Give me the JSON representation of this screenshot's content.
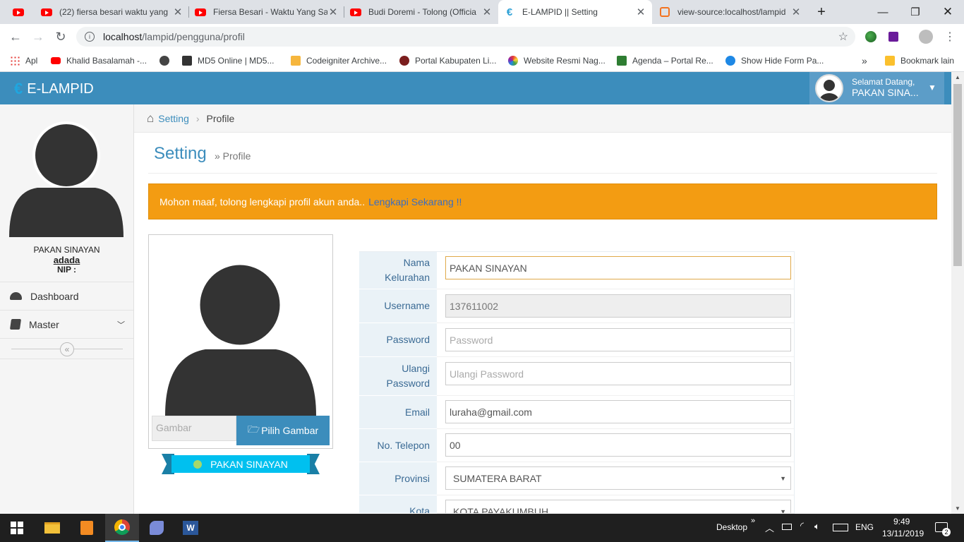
{
  "browser": {
    "tabs": [
      {
        "title": "(22) fiersa besari waktu yang",
        "icon": "youtube-icon"
      },
      {
        "title": "Fiersa Besari - Waktu Yang Sa",
        "icon": "youtube-icon"
      },
      {
        "title": "Budi Doremi - Tolong (Officia",
        "icon": "youtube-icon"
      },
      {
        "title": "E-LAMPID || Setting",
        "icon": "elampid-icon",
        "active": true
      },
      {
        "title": "view-source:localhost/lampid",
        "icon": "xampp-icon"
      }
    ],
    "url_host": "localhost",
    "url_path": "/lampid/pengguna/profil",
    "bookmarks": [
      {
        "label": "Apl"
      },
      {
        "label": "Khalid Basalamah -..."
      },
      {
        "label": ""
      },
      {
        "label": "MD5 Online | MD5..."
      },
      {
        "label": "Codeigniter Archive..."
      },
      {
        "label": "Portal Kabupaten Li..."
      },
      {
        "label": "Website Resmi Nag..."
      },
      {
        "label": "Agenda – Portal Re..."
      },
      {
        "label": "Show Hide Form Pa..."
      }
    ],
    "bookmark_more": "»",
    "bookmark_other": "Bookmark lain"
  },
  "app": {
    "brand": "E-LAMPID",
    "welcome": "Selamat Datang,",
    "user_short": "PAKAN SINA..."
  },
  "sidebar": {
    "user_name": "PAKAN SINAYAN",
    "user_role": "adada",
    "nip_label": "NIP :",
    "menu": [
      {
        "label": "Dashboard",
        "icon": "dashboard-icon"
      },
      {
        "label": "Master",
        "icon": "book-icon"
      }
    ]
  },
  "breadcrumb": {
    "home": "Setting",
    "current": "Profile"
  },
  "page": {
    "title": "Setting",
    "subtitle": "» Profile"
  },
  "alert": {
    "text": "Mohon maaf, tolong lengkapi profil akun anda..",
    "link": "Lengkapi Sekarang !!"
  },
  "photo": {
    "file_placeholder": "Gambar",
    "choose_label": "Pilih Gambar",
    "name_ribbon": "PAKAN SINAYAN"
  },
  "form": {
    "nama_label": "Nama Kelurahan",
    "nama_value": "PAKAN SINAYAN",
    "username_label": "Username",
    "username_value": "137611002",
    "password_label": "Password",
    "password_placeholder": "Password",
    "ulangi_label": "Ulangi Password",
    "ulangi_placeholder": "Ulangi Password",
    "email_label": "Email",
    "email_value": "luraha@gmail.com",
    "telepon_label": "No. Telepon",
    "telepon_value": "00",
    "provinsi_label": "Provinsi",
    "provinsi_value": "SUMATERA BARAT",
    "kota_label": "Kota",
    "kota_value": "KOTA PAYAKUMBUH"
  },
  "taskbar": {
    "desktop": "Desktop",
    "lang": "ENG",
    "time": "9:49",
    "date": "13/11/2019",
    "notifications": "2"
  },
  "colors": {
    "header": "#3c8dbc",
    "alert": "#f39c12",
    "button": "#3c8dbc",
    "ribbon": "#00c0ef"
  }
}
